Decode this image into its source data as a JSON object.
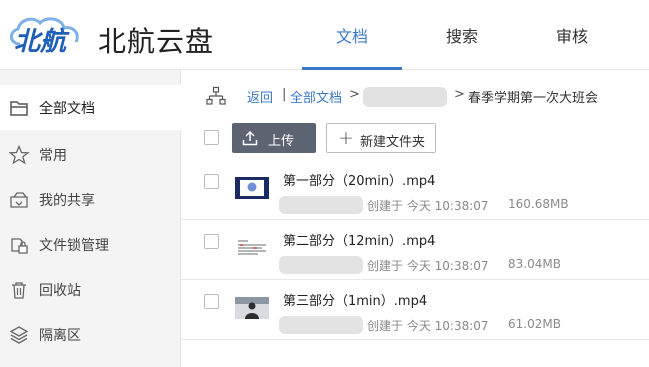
{
  "app": {
    "brand": "北航云盘",
    "logo_text": "北航"
  },
  "header_nav": [
    {
      "label": "文档",
      "active": true
    },
    {
      "label": "搜索",
      "active": false
    },
    {
      "label": "审核",
      "active": false
    }
  ],
  "sidebar": {
    "items": [
      {
        "label": "全部文档",
        "icon": "folder-icon",
        "active": true
      },
      {
        "label": "常用",
        "icon": "star-icon",
        "active": false
      },
      {
        "label": "我的共享",
        "icon": "share-icon",
        "active": false
      },
      {
        "label": "文件锁管理",
        "icon": "lock-icon",
        "active": false
      },
      {
        "label": "回收站",
        "icon": "trash-icon",
        "active": false
      },
      {
        "label": "隔离区",
        "icon": "layers-icon",
        "active": false
      }
    ]
  },
  "breadcrumb": {
    "back": "返回",
    "separator": "|",
    "root": "全部文档",
    "arrow": ">",
    "current": "春季学期第一次大班会"
  },
  "toolbar": {
    "upload": "上传",
    "new_folder": "新建文件夹"
  },
  "files": [
    {
      "name": "第一部分（20min）.mp4",
      "created": "创建于 今天 10:38:07",
      "size": "160.68MB",
      "thumb": "video-thumb-1"
    },
    {
      "name": "第二部分（12min）.mp4",
      "created": "创建于 今天 10:38:07",
      "size": "83.04MB",
      "thumb": "video-thumb-2"
    },
    {
      "name": "第三部分（1min）.mp4",
      "created": "创建于 今天 10:38:07",
      "size": "61.02MB",
      "thumb": "video-thumb-3"
    }
  ],
  "colors": {
    "accent": "#3b78c8",
    "upload_button": "#5b6470",
    "sidebar_bg": "#f4f4f4"
  }
}
